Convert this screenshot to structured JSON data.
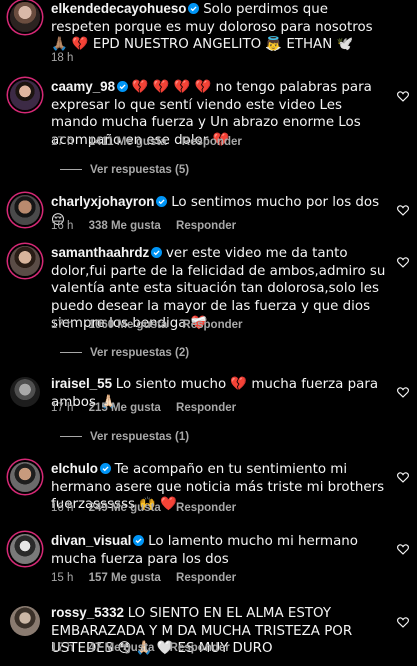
{
  "comments": [
    {
      "username": "elkendedecayohueso",
      "verified": true,
      "text": "Solo perdimos que respeten porque es muy doloroso para nosotros 🙏🏽 💔 EPD NUESTRO ANGELITO 👼 ETHAN 🕊️",
      "time": "18 h",
      "likes": "",
      "reply": ""
    },
    {
      "username": "caamy_98",
      "verified": true,
      "text": "💔 💔 💔 💔 no tengo palabras para expresar lo que sentí viendo este video Les mando mucha fuerza y Un abrazo enorme Los acompaño en ese dolor 💔",
      "time": "17 h",
      "likes": "1411 Me gusta",
      "reply": "Responder",
      "view_replies": "Ver respuestas (5)"
    },
    {
      "username": "charlyxjohayron",
      "verified": true,
      "text": "Lo sentimos mucho por los dos 😔",
      "time": "16 h",
      "likes": "338 Me gusta",
      "reply": "Responder"
    },
    {
      "username": "samanthaahrdz",
      "verified": true,
      "text": "ver este video me da tanto dolor,fui parte de la felicidad de ambos,admiro su valentía ante esta situación tan dolorosa,solo les puedo desear la mayor de las fuerza y que dios siempre los bendiga ❤️‍🩹",
      "time": "17 h",
      "likes": "1060 Me gusta",
      "reply": "Responder",
      "view_replies": "Ver respuestas (2)"
    },
    {
      "username": "iraisel_55",
      "verified": false,
      "text": "Lo siento mucho 💔 mucha fuerza para ambos 🙏🏻",
      "time": "17 h",
      "likes": "215 Me gusta",
      "reply": "Responder",
      "view_replies": "Ver respuestas (1)"
    },
    {
      "username": "elchulo",
      "verified": true,
      "text": "Te acompaño en tu sentimiento mi hermano asere que noticia más triste mi brothers fuerzassssss 🙌 ❤️",
      "time": "16 h",
      "likes": "249 Me gusta",
      "reply": "Responder"
    },
    {
      "username": "divan_visual",
      "verified": true,
      "text": "Lo lamento mucho mi hermano mucha fuerza para los dos",
      "time": "15 h",
      "likes": "157 Me gusta",
      "reply": "Responder"
    },
    {
      "username": "rossy_5332",
      "verified": false,
      "text": "LO SIENTO EN EL ALMA ESTOY EMBARAZADA Y M DA MUCHA TRISTEZA POR USTEDES 😳 🙏🏻 🤍 ES MUY DURO",
      "time": "17 h",
      "likes": "47 Me gusta",
      "reply": "Responder"
    }
  ],
  "colors": {
    "accent": "#0095f6",
    "muted": "#a8a8a8",
    "background": "#000000"
  }
}
